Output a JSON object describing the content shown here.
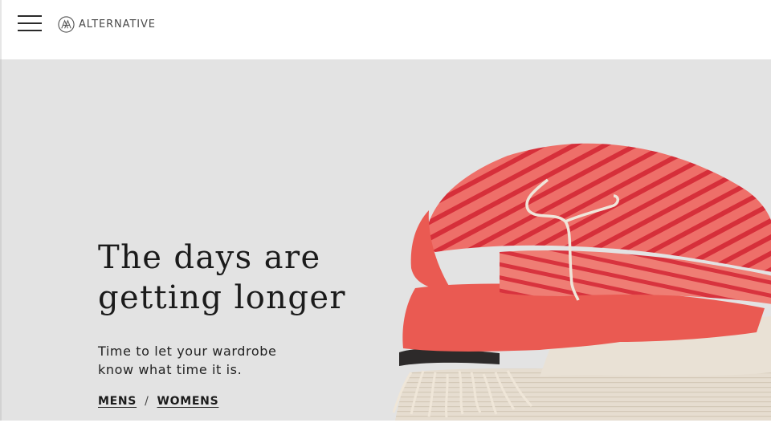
{
  "header": {
    "menu_icon": "hamburger-menu-icon",
    "logo_icon": "alternative-monogram-icon",
    "logo_text": "ALTERNATIVE"
  },
  "hero": {
    "headline_line1": "The days are",
    "headline_line2": "getting longer",
    "subcopy_line1": "Time to let your wardrobe",
    "subcopy_line2": "know what time it is.",
    "links": {
      "mens": "MENS",
      "separator": "/",
      "womens": "WOMENS"
    },
    "image_icon": "folded-clothes-stack-image"
  },
  "colors": {
    "hero_background": "#e3e3e3",
    "header_background": "#ffffff",
    "text": "#1b1b1b",
    "coral": "#e8564f",
    "stripe_red": "#d8333e",
    "cream": "#e7dfd2"
  }
}
